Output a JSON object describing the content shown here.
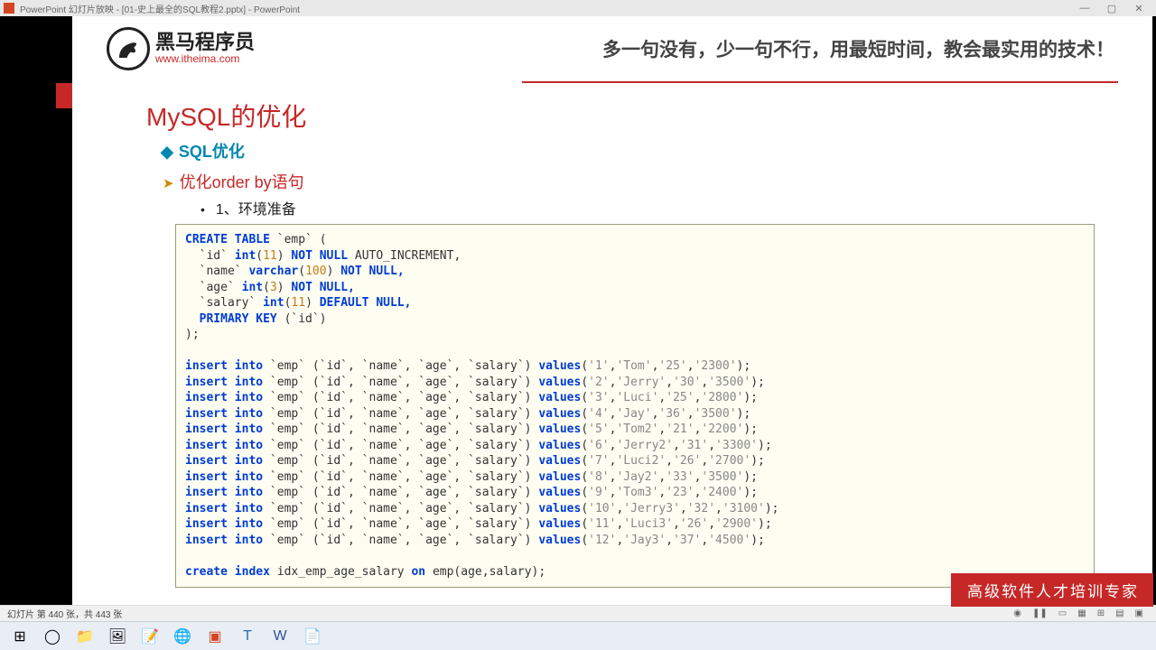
{
  "titlebar": {
    "text": "PowerPoint 幻灯片放映 - [01-史上最全的SQL教程2.pptx] - PowerPoint",
    "min": "—",
    "max": "▢",
    "close": "✕"
  },
  "logo": {
    "name": "黑马程序员",
    "url": "www.itheima.com"
  },
  "slogan": "多一句没有，少一句不行，用最短时间，教会最实用的技术！",
  "h1": "MySQL的优化",
  "sub1": "SQL优化",
  "sub2": "优化order by语句",
  "sub3": "1、环境准备",
  "sql": {
    "create_table": "CREATE TABLE",
    "emp": "`emp`",
    "lpar": "(",
    "id_col": {
      "name": "`id`",
      "type_kw": "int",
      "size": "11",
      "rest": "NOT NULL",
      "auto": "AUTO_INCREMENT,"
    },
    "name_col": {
      "name": "`name`",
      "type_kw": "varchar",
      "size": "100",
      "rest": "NOT NULL,"
    },
    "age_col": {
      "name": "`age`",
      "type_kw": "int",
      "size": "3",
      "rest": "NOT NULL,"
    },
    "salary_col": {
      "name": "`salary`",
      "type_kw": "int",
      "size": "11",
      "rest": "DEFAULT NULL,"
    },
    "pk": "PRIMARY KEY",
    "pk_col": "(`id`)",
    "end": ");",
    "insert_kw": "insert into",
    "cols_kw": "(`id`, `name`, `age`, `salary`)",
    "values_kw": "values",
    "rows": [
      {
        "id": "'1'",
        "name": "'Tom'",
        "age": "'25'",
        "salary": "'2300'"
      },
      {
        "id": "'2'",
        "name": "'Jerry'",
        "age": "'30'",
        "salary": "'3500'"
      },
      {
        "id": "'3'",
        "name": "'Luci'",
        "age": "'25'",
        "salary": "'2800'"
      },
      {
        "id": "'4'",
        "name": "'Jay'",
        "age": "'36'",
        "salary": "'3500'"
      },
      {
        "id": "'5'",
        "name": "'Tom2'",
        "age": "'21'",
        "salary": "'2200'"
      },
      {
        "id": "'6'",
        "name": "'Jerry2'",
        "age": "'31'",
        "salary": "'3300'"
      },
      {
        "id": "'7'",
        "name": "'Luci2'",
        "age": "'26'",
        "salary": "'2700'"
      },
      {
        "id": "'8'",
        "name": "'Jay2'",
        "age": "'33'",
        "salary": "'3500'"
      },
      {
        "id": "'9'",
        "name": "'Tom3'",
        "age": "'23'",
        "salary": "'2400'"
      },
      {
        "id": "'10'",
        "name": "'Jerry3'",
        "age": "'32'",
        "salary": "'3100'"
      },
      {
        "id": "'11'",
        "name": "'Luci3'",
        "age": "'26'",
        "salary": "'2900'"
      },
      {
        "id": "'12'",
        "name": "'Jay3'",
        "age": "'37'",
        "salary": "'4500'"
      }
    ],
    "create_index_kw": "create index",
    "index_name": "idx_emp_age_salary",
    "on_kw": "on",
    "index_target": "emp(age,salary);"
  },
  "footer_ribbon": "高级软件人才培训专家",
  "status": {
    "left": "幻灯片 第 440 张，共 443 张"
  }
}
